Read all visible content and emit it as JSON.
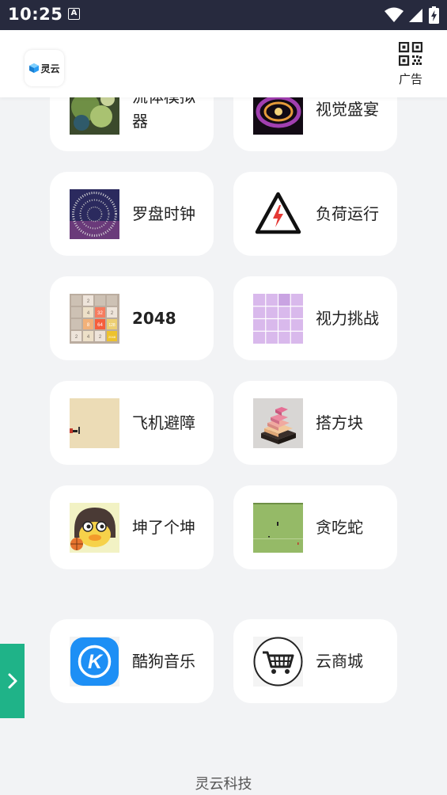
{
  "status_bar": {
    "time": "10:25",
    "a_badge": "A"
  },
  "header": {
    "logo_text": "灵云",
    "ad_label": "广告",
    "qr_icon": "qr-code-icon"
  },
  "apps": [
    {
      "label": "流体模拟器",
      "icon": "fluid-thumbnail"
    },
    {
      "label": "视觉盛宴",
      "icon": "particle-thumbnail"
    },
    {
      "label": "罗盘时钟",
      "icon": "compass-clock-thumbnail"
    },
    {
      "label": "负荷运行",
      "icon": "high-voltage-warning-icon"
    },
    {
      "label": "2048",
      "icon": "game-2048-thumbnail"
    },
    {
      "label": "视力挑战",
      "icon": "vision-grid-thumbnail"
    },
    {
      "label": "飞机避障",
      "icon": "plane-game-thumbnail"
    },
    {
      "label": "搭方块",
      "icon": "stack-blocks-thumbnail"
    },
    {
      "label": "坤了个坤",
      "icon": "cartoon-face-thumbnail"
    },
    {
      "label": "贪吃蛇",
      "icon": "snake-game-thumbnail"
    },
    {
      "label": "酷狗音乐",
      "icon": "kugou-music-icon"
    },
    {
      "label": "云商城",
      "icon": "shopping-cart-icon"
    }
  ],
  "tiles_2048": [
    "2",
    "4",
    "32",
    "2",
    "8",
    "64",
    "128",
    "2",
    "4",
    "2",
    "2048"
  ],
  "kugou_letter": "K",
  "footer_text": "灵云科技",
  "colors": {
    "status_bar": "#272a3e",
    "side_tab": "#1fb388",
    "kugou_blue": "#1d8ff5"
  }
}
